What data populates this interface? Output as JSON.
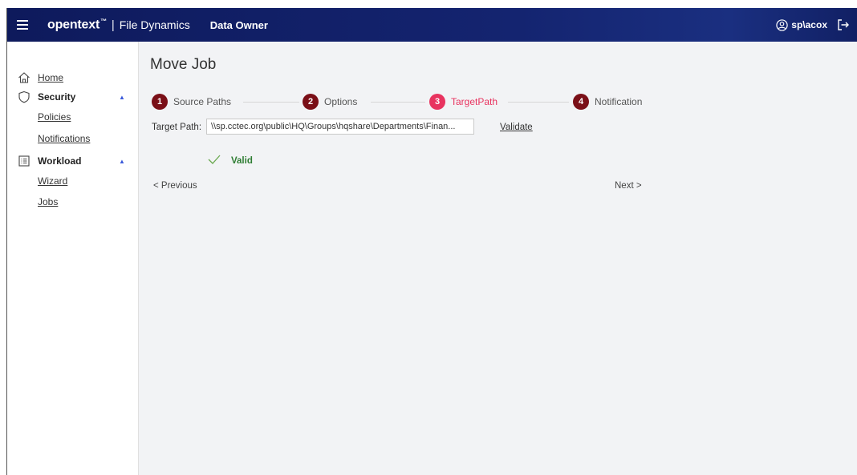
{
  "header": {
    "brand": "opentext",
    "brand_mark": "™",
    "separator": "|",
    "product": "File Dynamics",
    "role": "Data Owner",
    "username": "sp\\acox",
    "icons": {
      "menu": "hamburger-icon",
      "user": "user-circle-icon",
      "logout": "logout-icon"
    },
    "colors": {
      "bar": "#142470"
    }
  },
  "sidebar": {
    "items": [
      {
        "label": "Home",
        "icon": "home-icon"
      },
      {
        "label": "Security",
        "icon": "shield-icon",
        "expanded": true,
        "children": [
          {
            "label": "Policies"
          },
          {
            "label": "Notifications"
          }
        ]
      },
      {
        "label": "Workload",
        "icon": "list-icon",
        "expanded": true,
        "children": [
          {
            "label": "Wizard"
          },
          {
            "label": "Jobs"
          }
        ]
      }
    ]
  },
  "main": {
    "title": "Move Job",
    "steps": [
      {
        "number": "1",
        "label": "Source Paths",
        "active": false
      },
      {
        "number": "2",
        "label": "Options",
        "active": false
      },
      {
        "number": "3",
        "label": "TargetPath",
        "active": true
      },
      {
        "number": "4",
        "label": "Notification",
        "active": false
      }
    ],
    "target_path": {
      "label": "Target Path:",
      "value": "\\\\sp.cctec.org\\public\\HQ\\Groups\\hqshare\\Departments\\Finan..."
    },
    "validate_label": "Validate",
    "valid_label": "Valid",
    "previous_label": "< Previous",
    "next_label": "Next >",
    "colors": {
      "step_done": "#7a0f17",
      "step_active": "#e8335f",
      "valid": "#2e7d32"
    }
  }
}
